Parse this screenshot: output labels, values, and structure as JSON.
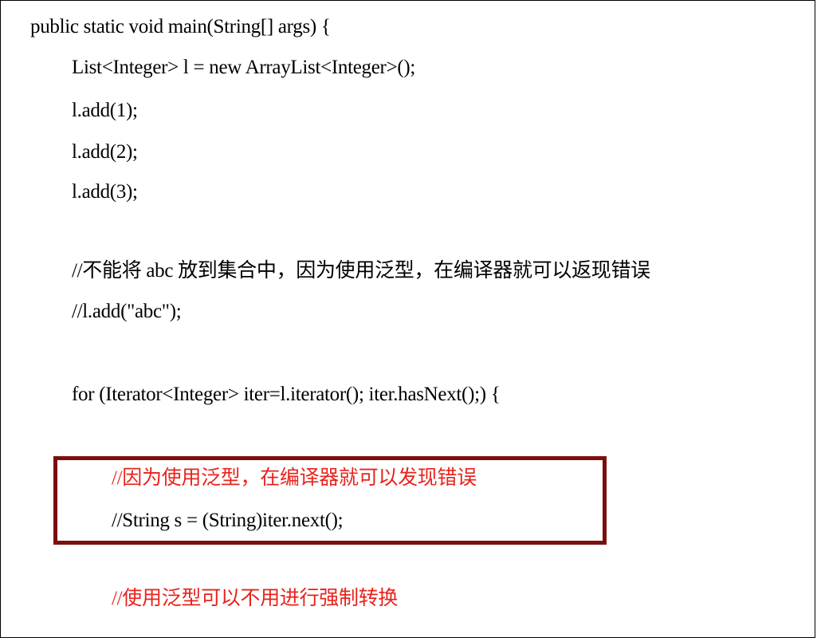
{
  "code": {
    "lines": [
      "public static void main(String[] args) {",
      "List<Integer> l = new ArrayList<Integer>();",
      "l.add(1);",
      "l.add(2);",
      "l.add(3);",
      "//不能将 abc 放到集合中，因为使用泛型，在编译器就可以返现错误",
      "//l.add(\"abc\");",
      "for (Iterator<Integer> iter=l.iterator(); iter.hasNext();) {",
      "//因为使用泛型，在编译器就可以发现错误",
      "//String s = (String)iter.next();",
      "//使用泛型可以不用进行强制转换"
    ]
  },
  "colors": {
    "text": "#000000",
    "comment_highlight": "#e8231c",
    "box_border": "#7b0f0f"
  }
}
